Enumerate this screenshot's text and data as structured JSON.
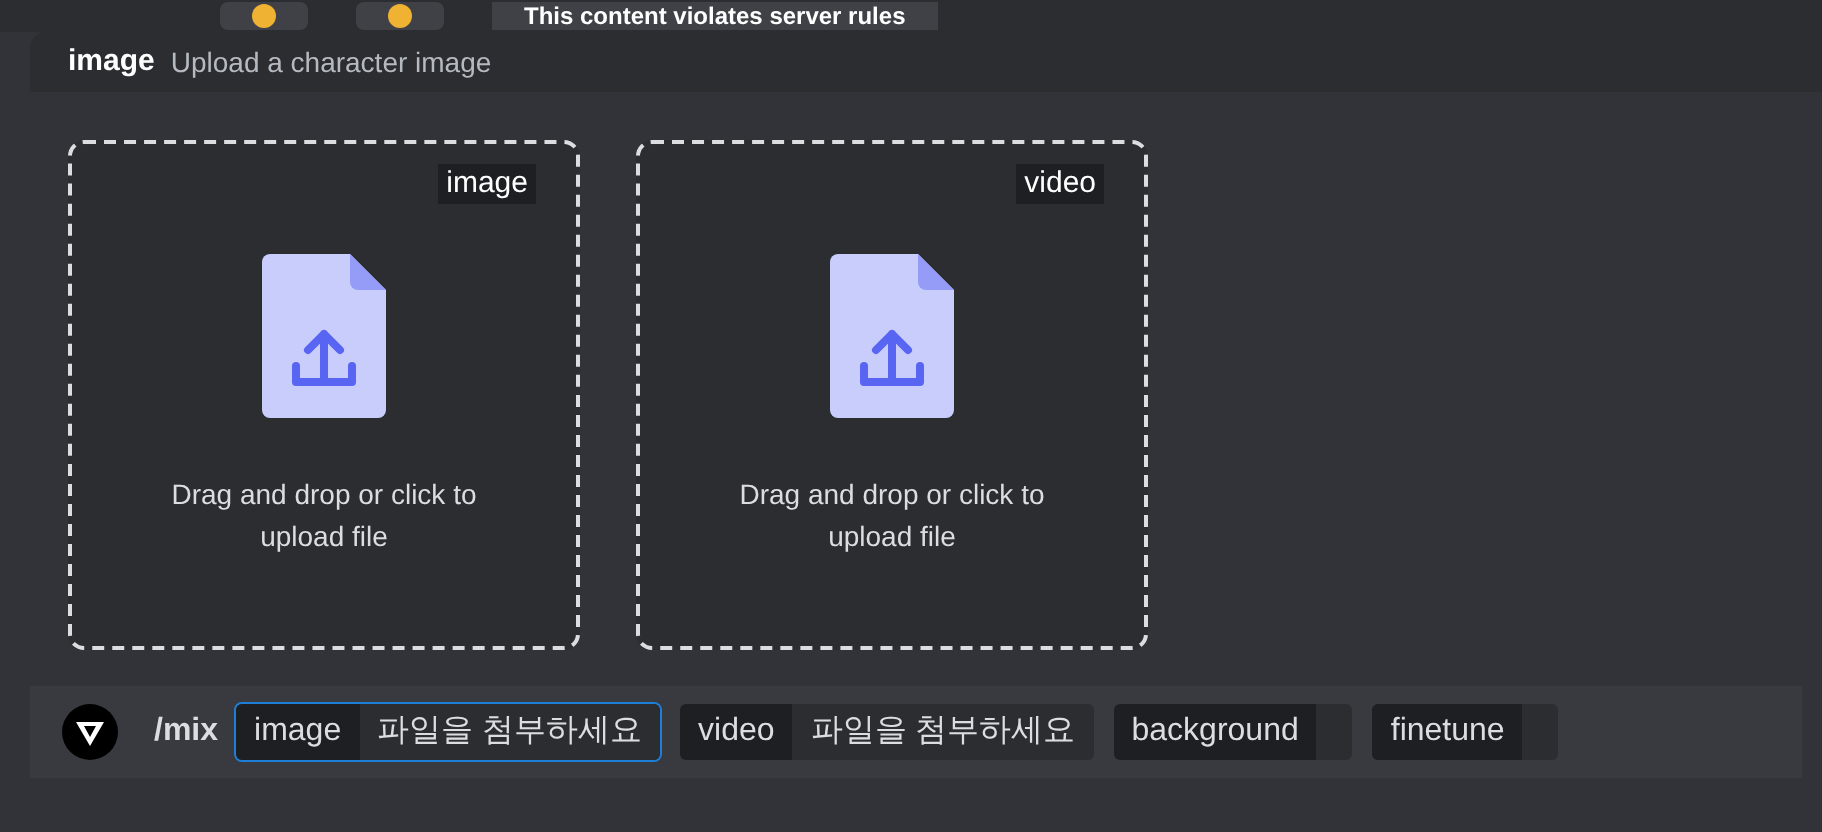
{
  "top_strip": {
    "message": "This content violates server rules"
  },
  "panel": {
    "title": "image",
    "subtitle": "Upload a character image"
  },
  "dropzones": [
    {
      "tag": "image",
      "hint": "Drag and drop or click to upload file"
    },
    {
      "tag": "video",
      "hint": "Drag and drop or click to upload file"
    }
  ],
  "command": {
    "name": "/mix",
    "options": [
      {
        "name": "image",
        "value": "파일을 첨부하세요",
        "selected": true
      },
      {
        "name": "video",
        "value": "파일을 첨부하세요",
        "selected": false
      },
      {
        "name": "background",
        "selected": false
      },
      {
        "name": "finetune",
        "selected": false
      }
    ]
  }
}
